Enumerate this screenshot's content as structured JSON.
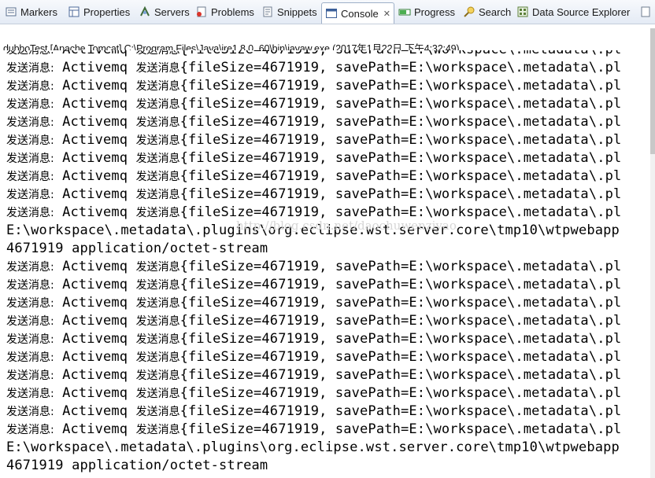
{
  "tabs": [
    {
      "label": "Markers",
      "icon": "markers-icon"
    },
    {
      "label": "Properties",
      "icon": "properties-icon"
    },
    {
      "label": "Servers",
      "icon": "servers-icon"
    },
    {
      "label": "Problems",
      "icon": "problems-icon"
    },
    {
      "label": "Snippets",
      "icon": "snippets-icon"
    },
    {
      "label": "Console",
      "icon": "console-icon",
      "active": true
    },
    {
      "label": "Progress",
      "icon": "progress-icon"
    },
    {
      "label": "Search",
      "icon": "search-icon"
    },
    {
      "label": "Data Source Explorer",
      "icon": "data-source-icon"
    }
  ],
  "console": {
    "title": "dubboTest [Apache Tomcat] C:\\Program Files\\Java\\jre1.8.0_60\\bin\\javaw.exe (2017年1月22日 下午4:32:49)",
    "send_prefix": "发送消息:",
    "send_mid": " Activemq ",
    "send_mid2": "发送消息",
    "send_payload": "{fileSize=4671919, savePath=E:\\workspace\\.metadata\\.pl",
    "path_line": "E:\\workspace\\.metadata\\.plugins\\org.eclipse.wst.server.core\\tmp10\\wtpwebapp",
    "mime_line": "4671919 application/octet-stream",
    "watermark": "http://blog.csdn.net/daochuwenziyao"
  },
  "colors": {
    "tabbar_top": "#f7f9fc",
    "tabbar_bottom": "#e4ebf5",
    "console_bg": "#ffffff",
    "text": "#000000"
  }
}
